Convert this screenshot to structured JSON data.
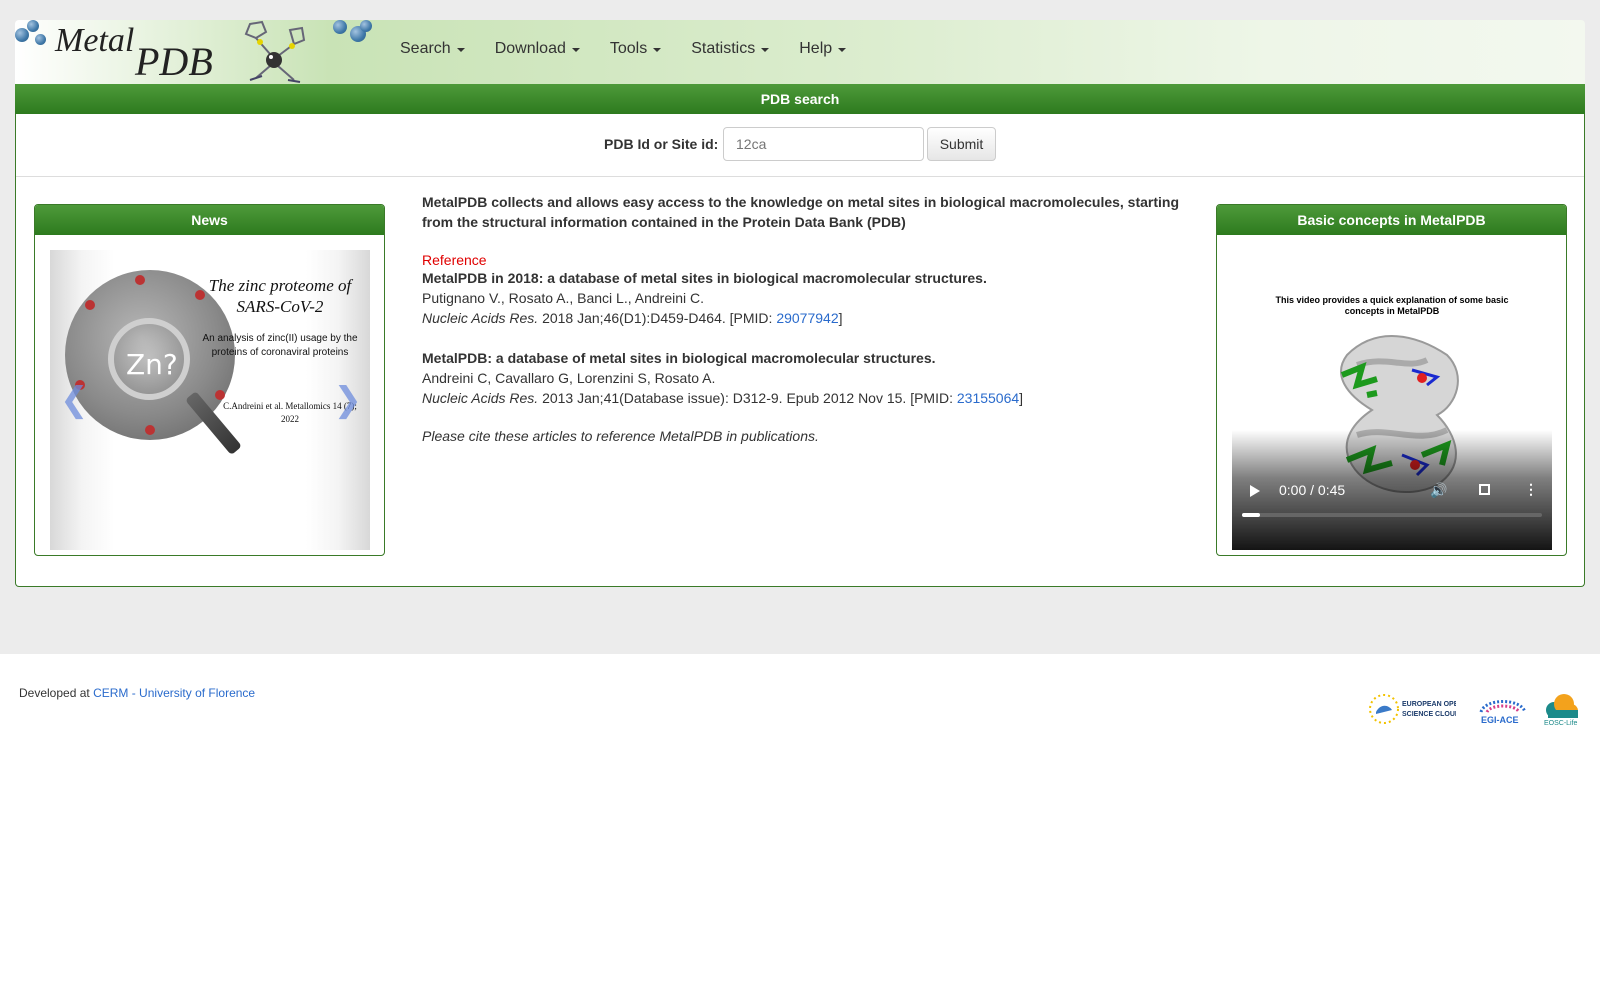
{
  "header": {
    "logo_metal": "Metal",
    "logo_pdb": "PDB",
    "nav": [
      "Search",
      "Download",
      "Tools",
      "Statistics",
      "Help"
    ]
  },
  "search": {
    "heading": "PDB search",
    "label": "PDB Id or Site id:",
    "placeholder": "12ca",
    "submit": "Submit"
  },
  "news": {
    "heading": "News",
    "slide_title": "The zinc proteome of SARS-CoV-2",
    "slide_subtitle": "An analysis of zinc(II) usage by the proteins of coronaviral proteins",
    "slide_authors": "C.Andreini et al. Metallomics 14 (7); 2022",
    "slide_lens_text": "Zn?"
  },
  "intro": "MetalPDB collects and allows easy access to the knowledge on metal sites in biological macromolecules, starting from the structural information contained in the Protein Data Bank (PDB)",
  "reference": {
    "label": "Reference",
    "items": [
      {
        "title": "MetalPDB in 2018: a database of metal sites in biological macromolecular structures.",
        "authors": "Putignano V., Rosato A., Banci L., Andreini C.",
        "journal": "Nucleic Acids Res.",
        "details": " 2018 Jan;46(D1):D459-D464. [PMID: ",
        "pmid": "29077942",
        "close": "]"
      },
      {
        "title": "MetalPDB: a database of metal sites in biological macromolecular structures.",
        "authors": "Andreini C, Cavallaro G, Lorenzini S, Rosato A.",
        "journal": "Nucleic Acids Res.",
        "details": " 2013 Jan;41(Database issue): D312-9. Epub 2012 Nov 15. [PMID: ",
        "pmid": "23155064",
        "close": "]"
      }
    ],
    "cite_note": "Please cite these articles to reference MetalPDB in publications."
  },
  "concepts": {
    "heading": "Basic concepts in MetalPDB",
    "video_caption": "This video provides a quick explanation of some basic concepts in MetalPDB",
    "time": "0:00 / 0:45",
    "progress": 0.06
  },
  "footer": {
    "developed_at": "Developed at ",
    "link": "CERM - University of Florence",
    "logos": [
      "EUROPEAN OPEN SCIENCE CLOUD",
      "EGI-ACE",
      "EOSC-Life"
    ]
  },
  "colors": {
    "header_green": "#2d7a1e",
    "link_blue": "#2a6bcc",
    "reference_red": "#e00000"
  }
}
